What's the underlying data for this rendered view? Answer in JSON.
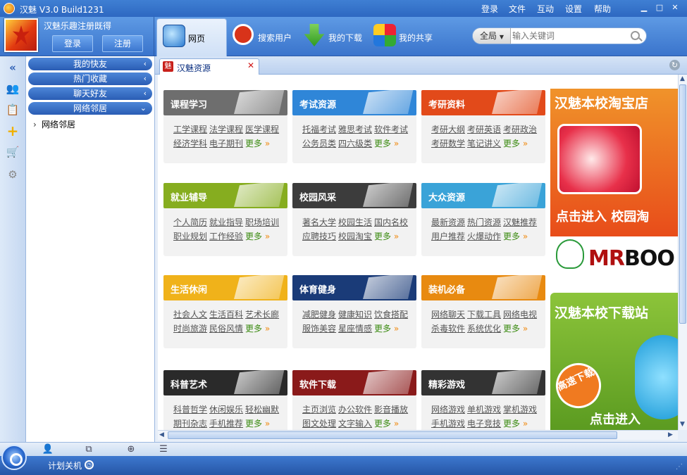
{
  "window": {
    "title": "汉魅 V3.0 Build1231",
    "menu": [
      "登录",
      "文件",
      "互动",
      "设置",
      "帮助"
    ],
    "controls": [
      "▁",
      "□",
      "✕"
    ]
  },
  "user": {
    "caption": "汉魅乐趣注册既得",
    "login_label": "登录",
    "register_label": "注册"
  },
  "nav": {
    "tabs": [
      {
        "label": "网页",
        "icon": "globe-icon"
      },
      {
        "label": "搜索用户",
        "icon": "magnifier-icon"
      },
      {
        "label": "我的下载",
        "icon": "download-icon"
      },
      {
        "label": "我的共享",
        "icon": "share-icon"
      }
    ]
  },
  "search": {
    "scope": "全局",
    "placeholder": "输入关键词"
  },
  "sidebar": {
    "groups": [
      {
        "label": "我的快友",
        "chevron": "‹"
      },
      {
        "label": "热门收藏",
        "chevron": "‹"
      },
      {
        "label": "聊天好友",
        "chevron": "‹"
      },
      {
        "label": "网络邻居",
        "chevron": "⌄"
      }
    ],
    "tree_item": "网络邻居"
  },
  "content": {
    "tab_label": "汉魅资源",
    "tab_icon_char": "魅"
  },
  "categories": [
    {
      "title": "课程学习",
      "color": "#6e6e6e",
      "links": [
        "工学课程",
        "法学课程",
        "医学课程",
        "经济学科",
        "电子期刊"
      ],
      "more": "更多"
    },
    {
      "title": "考试资源",
      "color": "#2f86d8",
      "links": [
        "托福考试",
        "雅思考试",
        "软件考试",
        "公务员类",
        "四六级类"
      ],
      "more": "更多"
    },
    {
      "title": "考研资料",
      "color": "#e24a1a",
      "links": [
        "考研大纲",
        "考研英语",
        "考研政治",
        "考研数学",
        "笔记讲义"
      ],
      "more": "更多"
    },
    {
      "title": "就业辅导",
      "color": "#86ad1f",
      "links": [
        "个人简历",
        "就业指导",
        "职场培训",
        "职业规划",
        "工作经验"
      ],
      "more": "更多"
    },
    {
      "title": "校园风采",
      "color": "#3c3c3c",
      "links": [
        "著名大学",
        "校园生活",
        "国内名校",
        "应聘技巧",
        "校园淘宝"
      ],
      "more": "更多"
    },
    {
      "title": "大众资源",
      "color": "#3aa3d8",
      "links": [
        "最新资源",
        "热门资源",
        "汉魅推荐",
        "用户推荐",
        "火爆动作"
      ],
      "more": "更多"
    },
    {
      "title": "生活休闲",
      "color": "#f0b21a",
      "links": [
        "社会人文",
        "生活百科",
        "艺术长廊",
        "时尚旅游",
        "民俗风情"
      ],
      "more": "更多"
    },
    {
      "title": "体育健身",
      "color": "#1a3b78",
      "links": [
        "减肥健身",
        "健康知识",
        "饮食搭配",
        "服饰美容",
        "星座情感"
      ],
      "more": "更多"
    },
    {
      "title": "装机必备",
      "color": "#e88a10",
      "links": [
        "网络聊天",
        "下载工具",
        "网络电视",
        "杀毒软件",
        "系统优化"
      ],
      "more": "更多"
    },
    {
      "title": "科普艺术",
      "color": "#2a2a2a",
      "links": [
        "科普哲学",
        "休闲娱乐",
        "轻松幽默",
        "期刊杂志",
        "手机推荐"
      ],
      "more": "更多"
    },
    {
      "title": "软件下载",
      "color": "#8a1a1a",
      "links": [
        "主页浏览",
        "办公软件",
        "影音播放",
        "图文处理",
        "文字输入"
      ],
      "more": "更多"
    },
    {
      "title": "精彩游戏",
      "color": "#333333",
      "links": [
        "网络游戏",
        "单机游戏",
        "掌机游戏",
        "手机游戏",
        "电子竞技"
      ],
      "more": "更多"
    }
  ],
  "ads": {
    "taobao_title": "汉魅本校淘宝店",
    "taobao_cta": "点击进入 校园淘",
    "brand": "MRBOO",
    "download_title": "汉魅本校下载站",
    "speed_badge": "高速下载",
    "download_cta": "点击进入"
  },
  "status": {
    "shutdown_label": "计划关机"
  }
}
